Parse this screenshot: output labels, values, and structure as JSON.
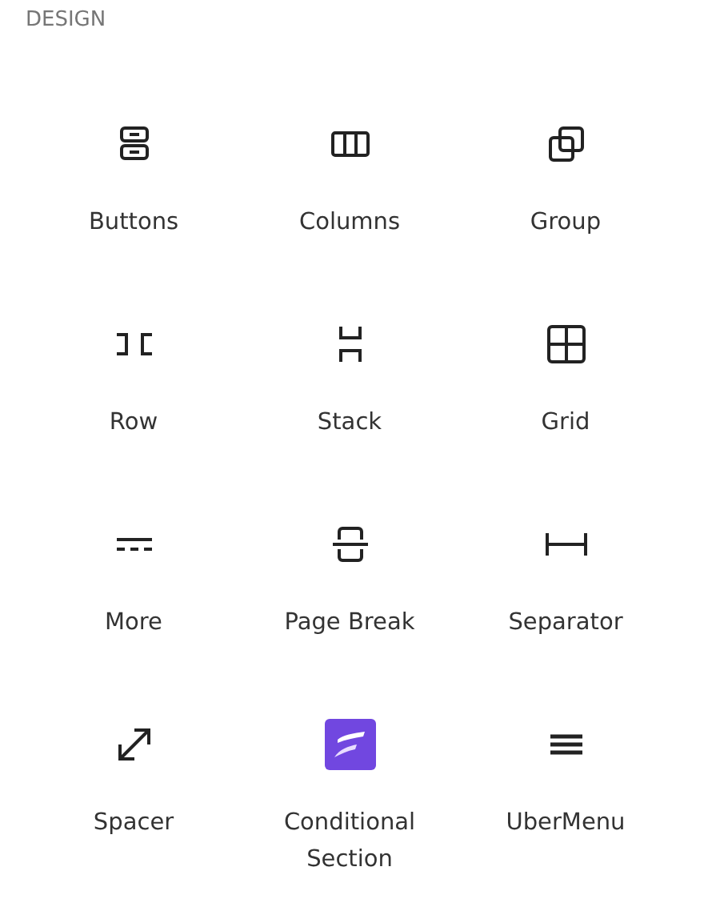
{
  "section_title": "DESIGN",
  "blocks": [
    {
      "label": "Buttons",
      "kind": "buttons"
    },
    {
      "label": "Columns",
      "kind": "columns"
    },
    {
      "label": "Group",
      "kind": "group"
    },
    {
      "label": "Row",
      "kind": "row"
    },
    {
      "label": "Stack",
      "kind": "stack"
    },
    {
      "label": "Grid",
      "kind": "grid"
    },
    {
      "label": "More",
      "kind": "more"
    },
    {
      "label": "Page Break",
      "kind": "pagebreak"
    },
    {
      "label": "Separator",
      "kind": "separator"
    },
    {
      "label": "Spacer",
      "kind": "spacer"
    },
    {
      "label": "Conditional Section",
      "kind": "conditional"
    },
    {
      "label": "UberMenu",
      "kind": "menu"
    }
  ]
}
